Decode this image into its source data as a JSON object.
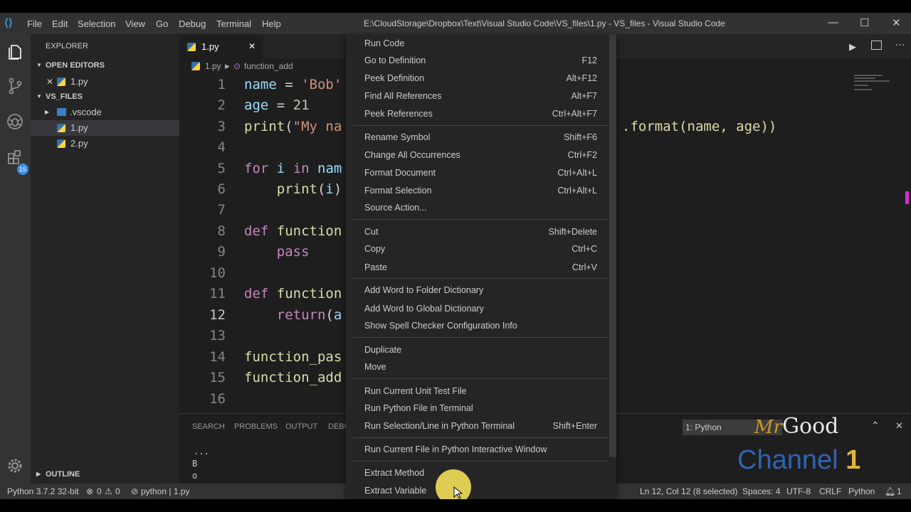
{
  "titlebar": {
    "menu": [
      "File",
      "Edit",
      "Selection",
      "View",
      "Go",
      "Debug",
      "Terminal",
      "Help"
    ],
    "title": "E:\\CloudStorage\\Dropbox\\Text\\Visual Studio Code\\VS_files\\1.py - VS_files - Visual Studio Code",
    "minimize": "—",
    "maximize": "☐",
    "close": "✕"
  },
  "activity": {
    "extensions_badge": "15"
  },
  "sidebar": {
    "title": "EXPLORER",
    "open_editors_label": "OPEN EDITORS",
    "open_editor_file": "1.py",
    "folder_label": "VS_FILES",
    "items": [
      ".vscode",
      "1.py",
      "2.py"
    ],
    "outline_label": "OUTLINE"
  },
  "editor": {
    "tab_label": "1.py",
    "breadcrumb_file": "1.py",
    "breadcrumb_symbol": "function_add",
    "line_numbers": [
      "1",
      "2",
      "3",
      "4",
      "5",
      "6",
      "7",
      "8",
      "9",
      "10",
      "11",
      "12",
      "13",
      "14",
      "15",
      "16"
    ],
    "right_fragment": ".format(name, age))"
  },
  "panel": {
    "tabs": [
      "SEARCH",
      "PROBLEMS",
      "OUTPUT",
      "DEBU"
    ],
    "terminal_select": "1: Python",
    "terminal_lines": [
      "...",
      "B",
      "o"
    ]
  },
  "context_menu": {
    "groups": [
      [
        {
          "label": "Run Code",
          "shortcut": ""
        },
        {
          "label": "Go to Definition",
          "shortcut": "F12"
        },
        {
          "label": "Peek Definition",
          "shortcut": "Alt+F12"
        },
        {
          "label": "Find All References",
          "shortcut": "Alt+F7"
        },
        {
          "label": "Peek References",
          "shortcut": "Ctrl+Alt+F7"
        }
      ],
      [
        {
          "label": "Rename Symbol",
          "shortcut": "Shift+F6"
        },
        {
          "label": "Change All Occurrences",
          "shortcut": "Ctrl+F2"
        },
        {
          "label": "Format Document",
          "shortcut": "Ctrl+Alt+L"
        },
        {
          "label": "Format Selection",
          "shortcut": "Ctrl+Alt+L"
        },
        {
          "label": "Source Action...",
          "shortcut": ""
        }
      ],
      [
        {
          "label": "Cut",
          "shortcut": "Shift+Delete"
        },
        {
          "label": "Copy",
          "shortcut": "Ctrl+C"
        },
        {
          "label": "Paste",
          "shortcut": "Ctrl+V"
        }
      ],
      [
        {
          "label": "Add Word to Folder Dictionary",
          "shortcut": ""
        },
        {
          "label": "Add Word to Global Dictionary",
          "shortcut": ""
        },
        {
          "label": "Show Spell Checker Configuration Info",
          "shortcut": ""
        }
      ],
      [
        {
          "label": "Duplicate",
          "shortcut": ""
        },
        {
          "label": "Move",
          "shortcut": ""
        }
      ],
      [
        {
          "label": "Run Current Unit Test File",
          "shortcut": ""
        },
        {
          "label": "Run Python File in Terminal",
          "shortcut": ""
        },
        {
          "label": "Run Selection/Line in Python Terminal",
          "shortcut": "Shift+Enter"
        }
      ],
      [
        {
          "label": "Run Current File in Python Interactive Window",
          "shortcut": ""
        }
      ],
      [
        {
          "label": "Extract Method",
          "shortcut": ""
        },
        {
          "label": "Extract Variable",
          "shortcut": ""
        }
      ]
    ]
  },
  "status": {
    "interpreter": "Python 3.7.2 32-bit",
    "errors": "0",
    "warnings": "0",
    "terminal_info": "python | 1.py",
    "cursor": "Ln 12, Col 12 (8 selected)",
    "spaces": "Spaces: 4",
    "encoding": "UTF-8",
    "eol": "CRLF",
    "language": "Python",
    "notifications": "1"
  },
  "watermark": {
    "mr": "Mr",
    "good": "Good",
    "channel": "Channel",
    "one": "1"
  },
  "colors": {
    "accent": "#3a8ee6",
    "keyword": "#c586c0",
    "function": "#dcdcaa",
    "string": "#ce9178",
    "number": "#b5cea8"
  }
}
